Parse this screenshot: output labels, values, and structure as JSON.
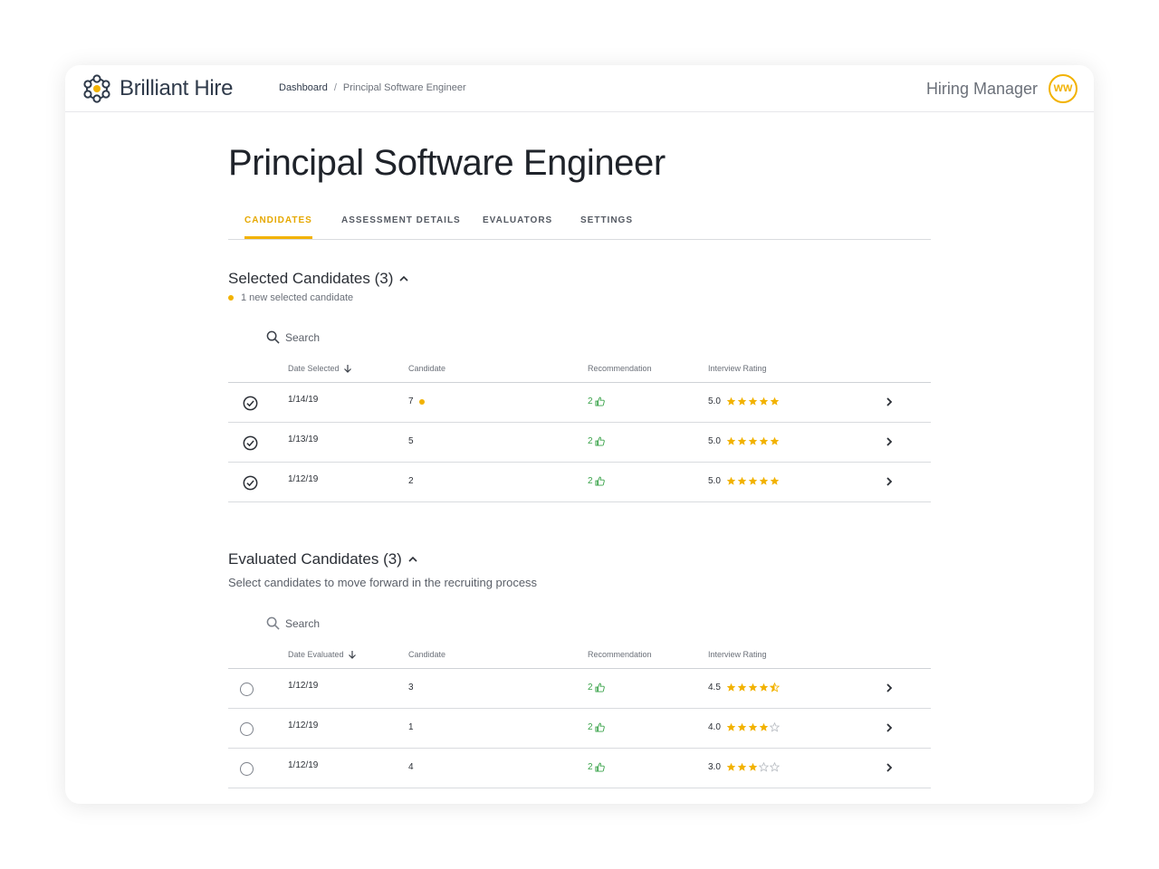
{
  "app": {
    "name": "Brilliant Hire"
  },
  "breadcrumb": {
    "home": "Dashboard",
    "separator": "/",
    "current": "Principal Software Engineer"
  },
  "user": {
    "role": "Hiring Manager",
    "initials": "WW"
  },
  "page": {
    "title": "Principal Software Engineer"
  },
  "tabs": [
    {
      "label": "CANDIDATES",
      "active": true
    },
    {
      "label": "ASSESSMENT DETAILS",
      "active": false
    },
    {
      "label": "EVALUATORS",
      "active": false
    },
    {
      "label": "SETTINGS",
      "active": false
    }
  ],
  "selected": {
    "title": "Selected Candidates (3)",
    "note": "1 new selected candidate",
    "search_placeholder": "Search",
    "columns": {
      "date": "Date Selected",
      "candidate": "Candidate",
      "recommendation": "Recommendation",
      "rating": "Interview Rating"
    },
    "rows": [
      {
        "date": "1/14/19",
        "candidate": "7",
        "new": true,
        "recommendation": "2",
        "rating": "5.0",
        "stars": 5
      },
      {
        "date": "1/13/19",
        "candidate": "5",
        "new": false,
        "recommendation": "2",
        "rating": "5.0",
        "stars": 5
      },
      {
        "date": "1/12/19",
        "candidate": "2",
        "new": false,
        "recommendation": "2",
        "rating": "5.0",
        "stars": 5
      }
    ]
  },
  "evaluated": {
    "title": "Evaluated Candidates (3)",
    "subtitle": "Select candidates to move forward in the recruiting process",
    "search_placeholder": "Search",
    "columns": {
      "date": "Date Evaluated",
      "candidate": "Candidate",
      "recommendation": "Recommendation",
      "rating": "Interview Rating"
    },
    "rows": [
      {
        "date": "1/12/19",
        "candidate": "3",
        "recommendation": "2",
        "rating": "4.5",
        "stars": 4.5
      },
      {
        "date": "1/12/19",
        "candidate": "1",
        "recommendation": "2",
        "rating": "4.0",
        "stars": 4
      },
      {
        "date": "1/12/19",
        "candidate": "4",
        "recommendation": "2",
        "rating": "3.0",
        "stars": 3
      }
    ]
  },
  "colors": {
    "accent": "#f2b200",
    "positive": "#3aa34a",
    "star_empty": "#b8bcc2"
  }
}
